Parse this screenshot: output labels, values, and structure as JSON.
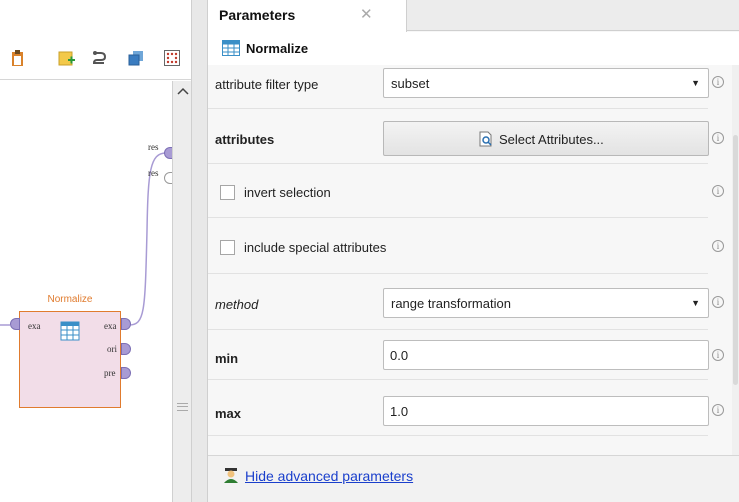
{
  "process_view": {
    "output_ports": [
      "res",
      "res"
    ],
    "operator": {
      "name": "Normalize",
      "input_ports": [
        "exa"
      ],
      "output_ports": [
        "exa",
        "ori",
        "pre"
      ]
    }
  },
  "parameters_panel": {
    "tab": {
      "label": "Parameters",
      "close_glyph": "✕"
    },
    "operator_name": "Normalize",
    "attribute_filter_type": {
      "label": "attribute filter type",
      "value": "subset"
    },
    "attributes": {
      "label": "attributes",
      "button_label": "Select Attributes..."
    },
    "invert_selection": {
      "label": "invert selection",
      "checked": false
    },
    "include_special_attributes": {
      "label": "include special attributes",
      "checked": false
    },
    "method": {
      "label": "method",
      "value": "range transformation"
    },
    "min": {
      "label": "min",
      "value": "0.0"
    },
    "max": {
      "label": "max",
      "value": "1.0"
    },
    "info_glyph": "i",
    "advanced_link": "Hide advanced parameters"
  },
  "icons": {
    "toolbar": [
      "clipboard-icon",
      "new-building-block-icon",
      "wiring-icon",
      "layers-icon",
      "grid-arrange-icon"
    ],
    "operator": "table-icon",
    "advanced": "expert-user-icon"
  },
  "colors": {
    "operator_title": "#e07b2e",
    "operator_fill": "#f2dde8",
    "port_filled": "#a89bd4",
    "link": "#1a3fcc"
  }
}
